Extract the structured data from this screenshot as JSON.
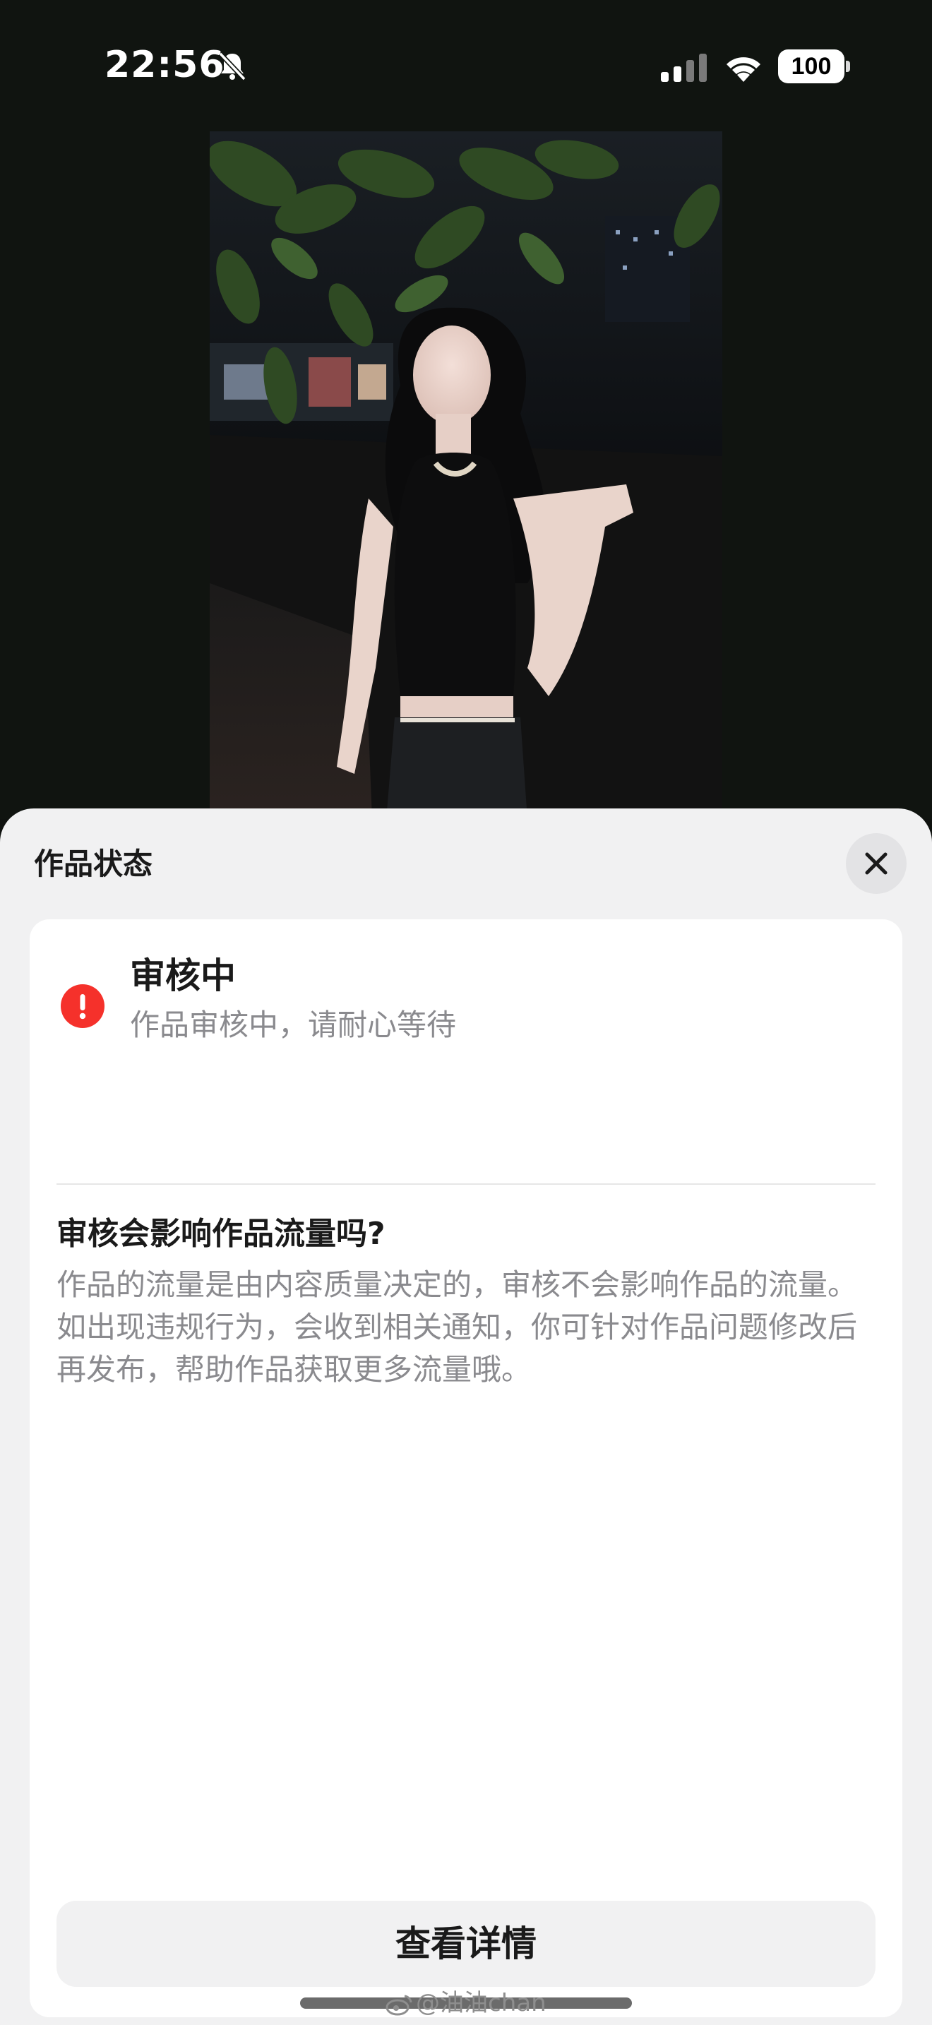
{
  "status_bar": {
    "time": "22:56",
    "battery": "100",
    "icons": [
      "bell-off-icon",
      "cellular-signal-icon",
      "wifi-icon",
      "battery-icon"
    ]
  },
  "sheet": {
    "title": "作品状态",
    "close_icon": "close-icon",
    "status": {
      "icon": "exclamation-circle-icon",
      "icon_color": "#f5312b",
      "title": "审核中",
      "subtitle": "作品审核中，请耐心等待"
    },
    "faq": {
      "question": "审核会影响作品流量吗?",
      "answer": "作品的流量是由内容质量决定的，审核不会影响作品的流量。如出现违规行为，会收到相关通知，你可针对作品问题修改后再发布，帮助作品获取更多流量哦。"
    },
    "detail_button_label": "查看详情"
  },
  "watermark": "@油油chan"
}
